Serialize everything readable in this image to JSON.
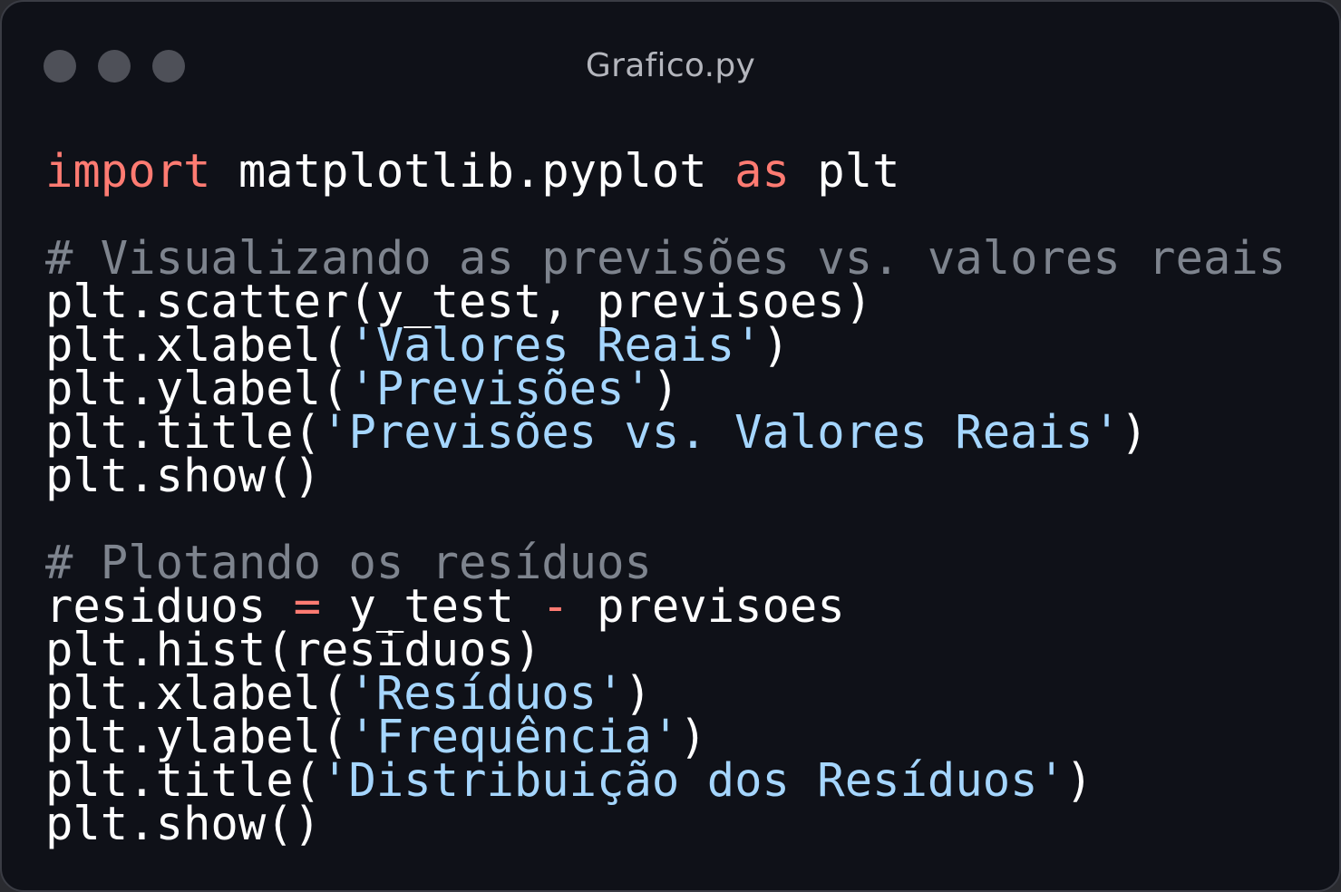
{
  "window": {
    "title": "Grafico.py",
    "controls": [
      "close",
      "minimize",
      "maximize"
    ]
  },
  "colors": {
    "background": "#0f1118",
    "keyword": "#ff7b72",
    "comment": "#7e848e",
    "string": "#a5d6ff",
    "plain": "#ffffff",
    "window_dot": "#4e5058"
  },
  "code": {
    "language": "python",
    "lines": [
      [
        {
          "t": "keyword",
          "v": "import"
        },
        {
          "t": "plain",
          "v": " matplotlib.pyplot "
        },
        {
          "t": "keyword",
          "v": "as"
        },
        {
          "t": "plain",
          "v": " plt"
        }
      ],
      [],
      [
        {
          "t": "comment",
          "v": "# Visualizando as previsões vs. valores reais"
        }
      ],
      [
        {
          "t": "plain",
          "v": "plt.scatter(y_test, previsoes)"
        }
      ],
      [
        {
          "t": "plain",
          "v": "plt.xlabel("
        },
        {
          "t": "string",
          "v": "'Valores Reais'"
        },
        {
          "t": "plain",
          "v": ")"
        }
      ],
      [
        {
          "t": "plain",
          "v": "plt.ylabel("
        },
        {
          "t": "string",
          "v": "'Previsões'"
        },
        {
          "t": "plain",
          "v": ")"
        }
      ],
      [
        {
          "t": "plain",
          "v": "plt.title("
        },
        {
          "t": "string",
          "v": "'Previsões vs. Valores Reais'"
        },
        {
          "t": "plain",
          "v": ")"
        }
      ],
      [
        {
          "t": "plain",
          "v": "plt.show()"
        }
      ],
      [],
      [
        {
          "t": "comment",
          "v": "# Plotando os resíduos"
        }
      ],
      [
        {
          "t": "plain",
          "v": "residuos "
        },
        {
          "t": "op",
          "v": "="
        },
        {
          "t": "plain",
          "v": " y_test "
        },
        {
          "t": "op",
          "v": "-"
        },
        {
          "t": "plain",
          "v": " previsoes"
        }
      ],
      [
        {
          "t": "plain",
          "v": "plt.hist(residuos)"
        }
      ],
      [
        {
          "t": "plain",
          "v": "plt.xlabel("
        },
        {
          "t": "string",
          "v": "'Resíduos'"
        },
        {
          "t": "plain",
          "v": ")"
        }
      ],
      [
        {
          "t": "plain",
          "v": "plt.ylabel("
        },
        {
          "t": "string",
          "v": "'Frequência'"
        },
        {
          "t": "plain",
          "v": ")"
        }
      ],
      [
        {
          "t": "plain",
          "v": "plt.title("
        },
        {
          "t": "string",
          "v": "'Distribuição dos Resíduos'"
        },
        {
          "t": "plain",
          "v": ")"
        }
      ],
      [
        {
          "t": "plain",
          "v": "plt.show()"
        }
      ]
    ]
  }
}
